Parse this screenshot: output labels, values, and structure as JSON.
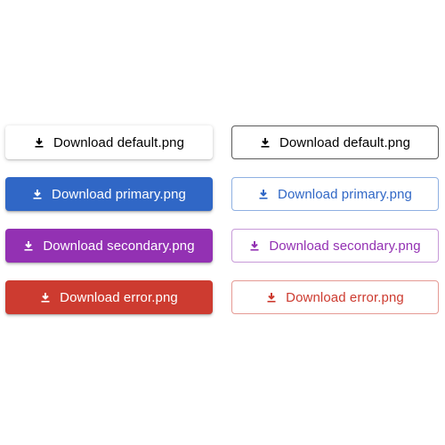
{
  "buttons": {
    "contained": {
      "default": {
        "label": "Download default.png",
        "icon": "download-icon"
      },
      "primary": {
        "label": "Download primary.png",
        "icon": "download-icon"
      },
      "secondary": {
        "label": "Download secondary.png",
        "icon": "download-icon"
      },
      "error": {
        "label": "Download error.png",
        "icon": "download-icon"
      }
    },
    "outlined": {
      "default": {
        "label": "Download default.png",
        "icon": "download-icon"
      },
      "primary": {
        "label": "Download primary.png",
        "icon": "download-icon"
      },
      "secondary": {
        "label": "Download secondary.png",
        "icon": "download-icon"
      },
      "error": {
        "label": "Download error.png",
        "icon": "download-icon"
      }
    }
  },
  "colors": {
    "primary": "#3067c6",
    "secondary": "#9331b3",
    "error": "#cd3b30",
    "default": "#000000"
  }
}
